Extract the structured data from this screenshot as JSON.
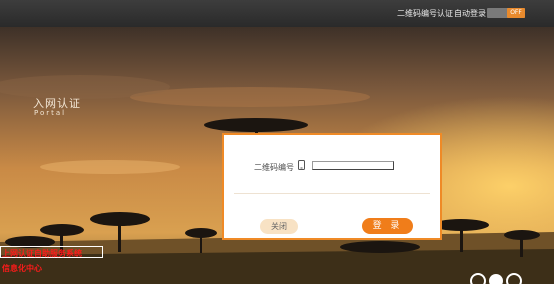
{
  "topbar": {
    "qr_auth_label": "二维码编号认证",
    "auto_login_label": "自动登录",
    "toggle_state": "OFF"
  },
  "portal": {
    "title": "入网认证",
    "subtitle": "Portal"
  },
  "dialog": {
    "qr_label": "二维码编号",
    "qr_input_value": "",
    "close_button": "关闭",
    "login_button": "登 录"
  },
  "footer": {
    "line1": "上网认证自助服务系统",
    "line2": "信息化中心"
  },
  "colors": {
    "accent": "#f07d1a",
    "topbar": "#333333",
    "footer_text": "#ff1a1a"
  },
  "icons": [
    "phone-icon",
    "corner-circle-icon"
  ]
}
